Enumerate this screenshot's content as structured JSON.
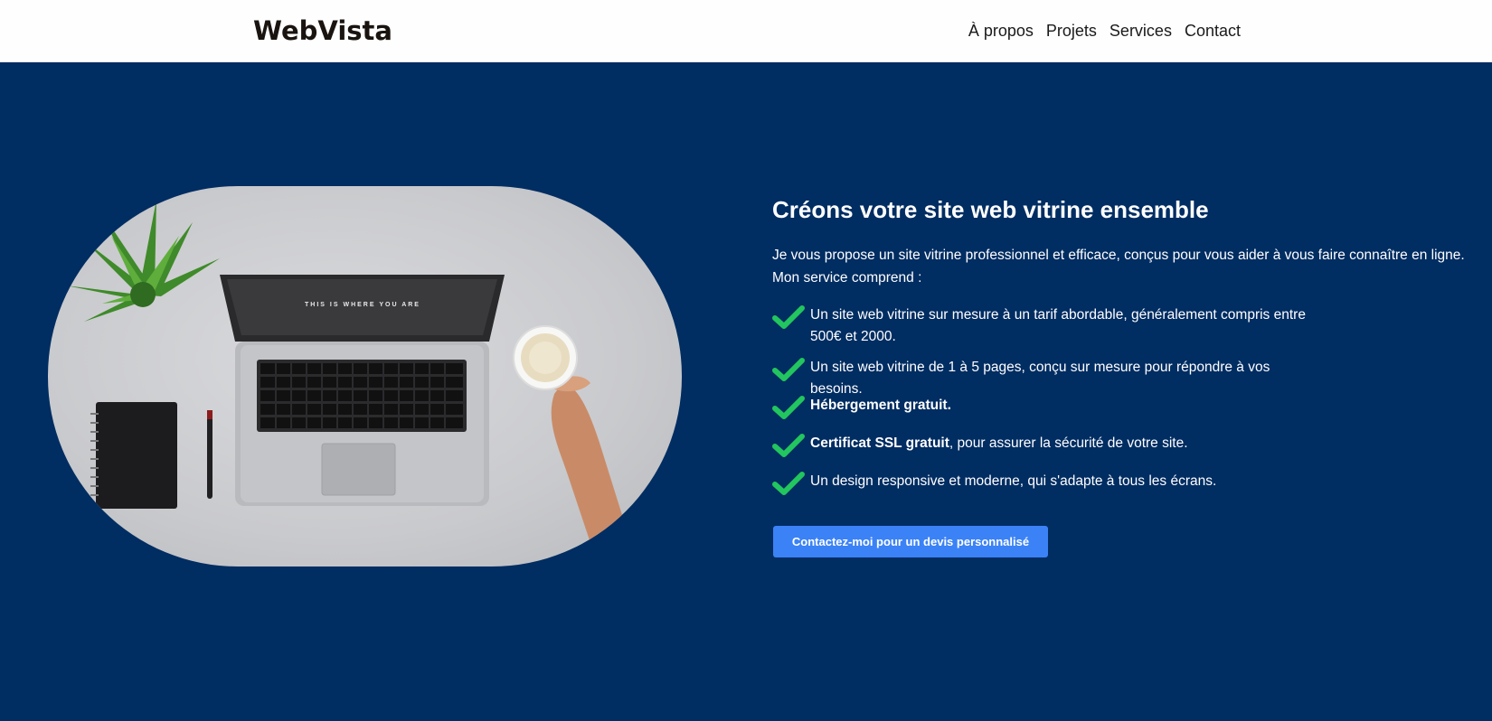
{
  "header": {
    "brand": "WebVista",
    "nav": [
      {
        "label": "À propos"
      },
      {
        "label": "Projets"
      },
      {
        "label": "Services"
      },
      {
        "label": "Contact"
      }
    ]
  },
  "hero": {
    "title": "Créons votre site web vitrine ensemble",
    "intro_line1": "Je vous propose un site vitrine professionnel et efficace, conçus pour vous aider à vous faire connaître en ligne.",
    "intro_line2": "Mon service comprend :",
    "features": [
      {
        "bold": "",
        "text": "Un site web vitrine sur mesure à un tarif abordable, généralement compris entre 500€ et 2000."
      },
      {
        "bold": "",
        "text": "Un site web vitrine de 1 à 5 pages, conçu sur mesure pour répondre à vos besoins."
      },
      {
        "bold": "Hébergement gratuit.",
        "text": ""
      },
      {
        "bold": "Certificat SSL gratuit",
        "text": ", pour assurer la sécurité de votre site."
      },
      {
        "bold": "",
        "text": "Un design responsive et moderne, qui s'adapte à tous les écrans."
      }
    ],
    "cta_label": "Contactez-moi pour un devis personnalisé",
    "laptop_screen_text": "THIS IS WHERE YOU ARE"
  },
  "icons": {
    "check": "checkmark-icon"
  },
  "colors": {
    "background": "#002d62",
    "header_bg": "#fefefe",
    "check": "#22c55e",
    "cta": "#3b82f6",
    "brand_text": "#1a1410"
  }
}
